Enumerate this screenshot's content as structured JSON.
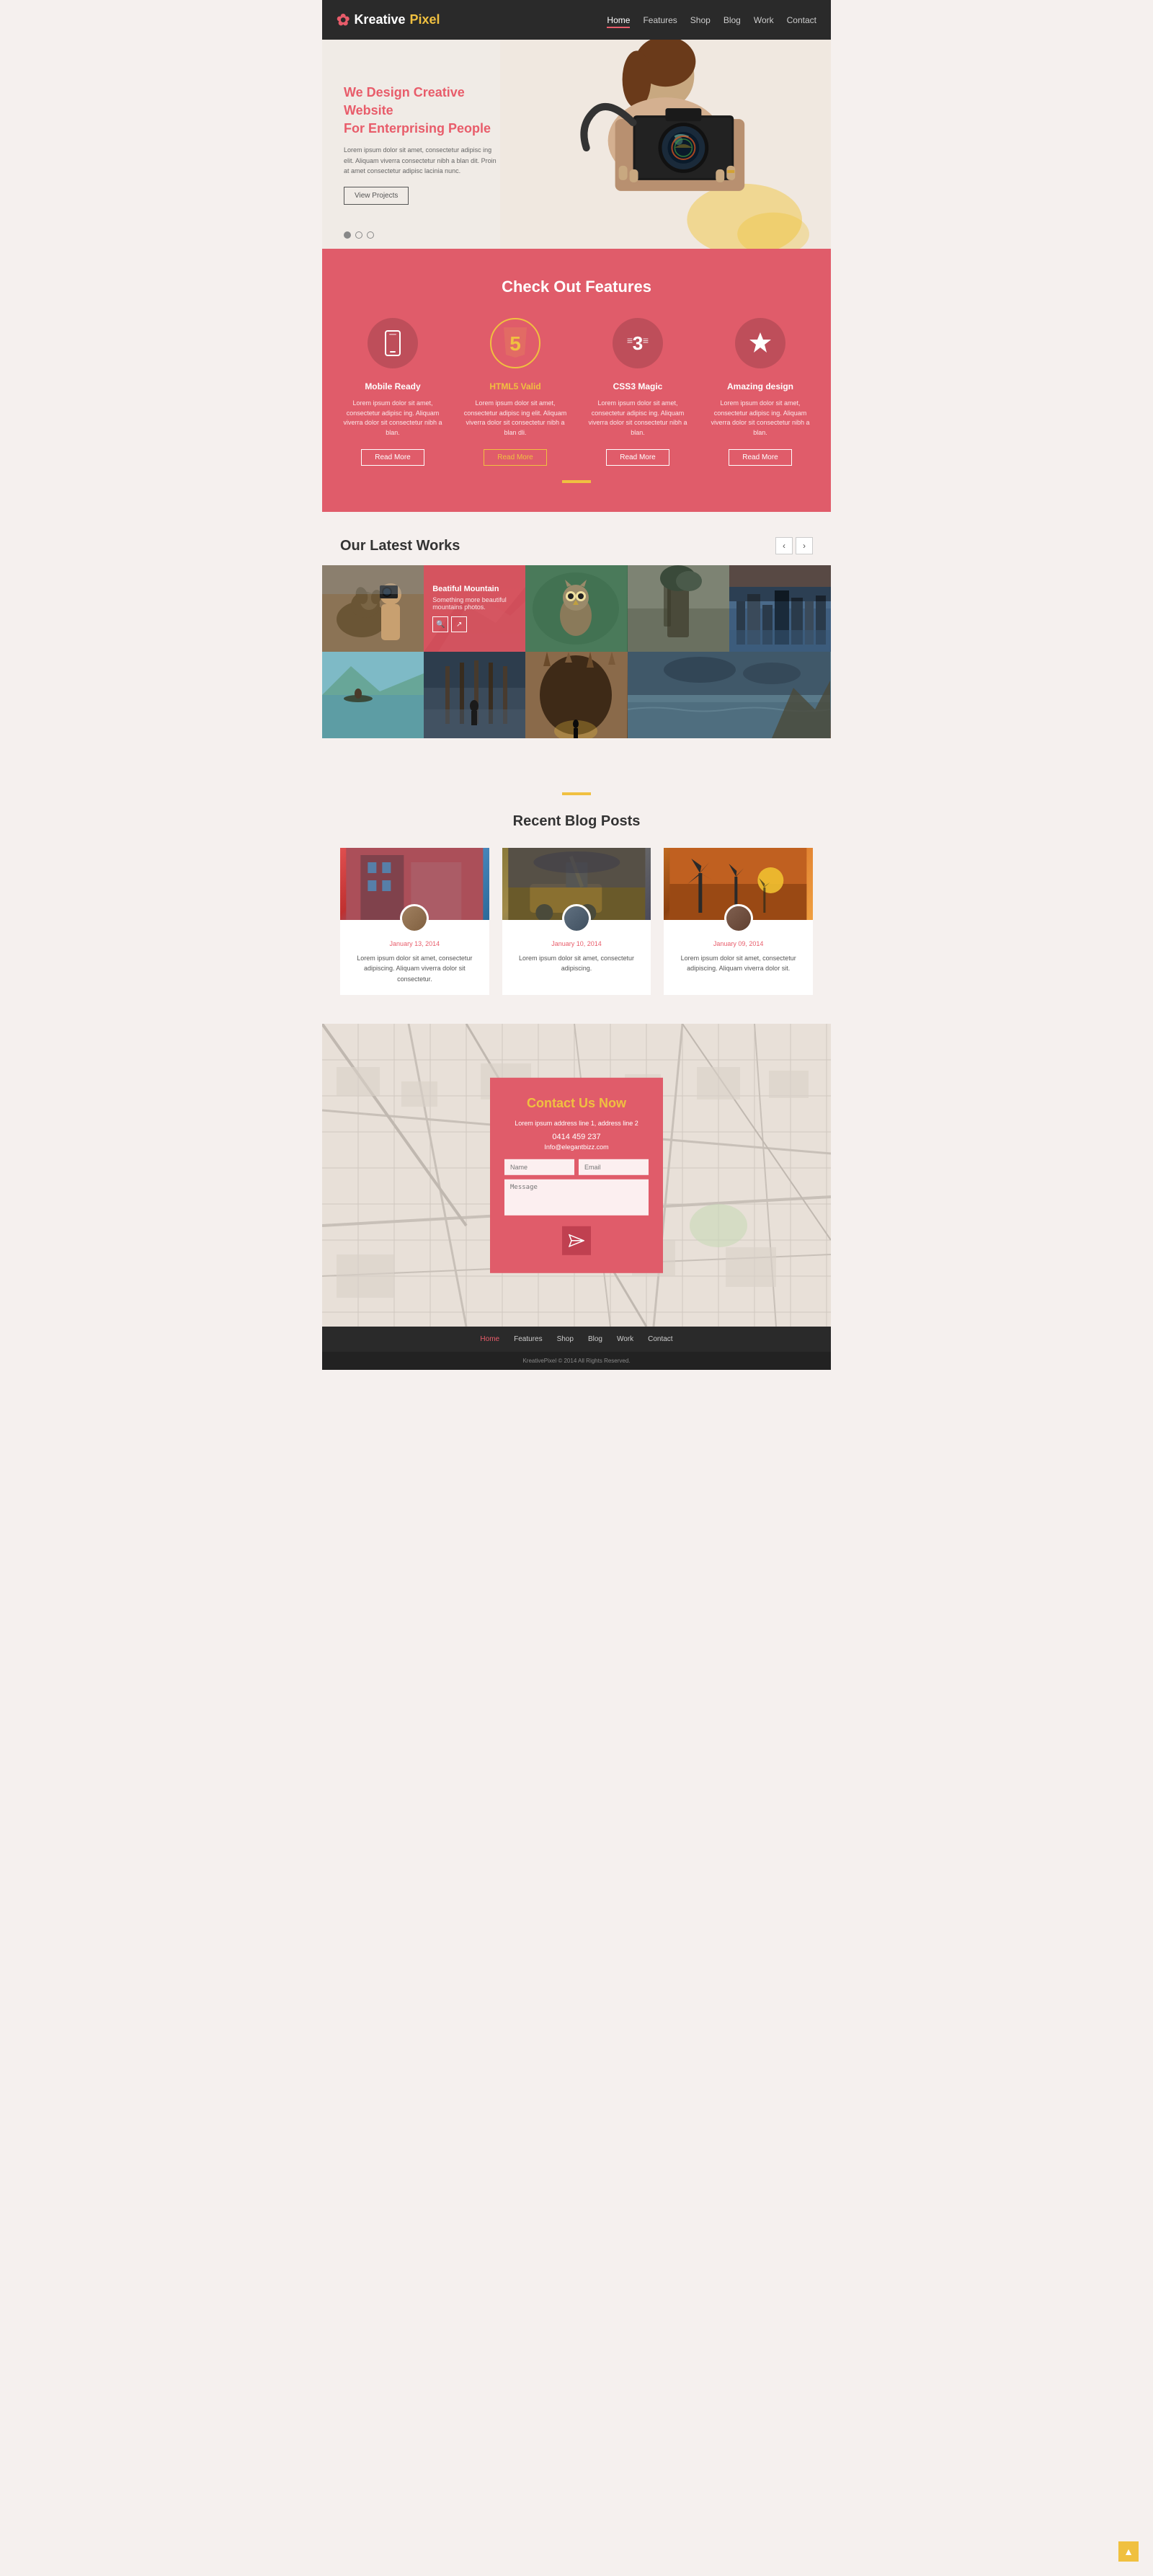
{
  "brand": {
    "logo_symbol": "✿",
    "name_kreative": "Kreative",
    "name_pixel": "Pixel"
  },
  "nav": {
    "links": [
      {
        "label": "Home",
        "active": true
      },
      {
        "label": "Features",
        "active": false
      },
      {
        "label": "Shop",
        "active": false
      },
      {
        "label": "Blog",
        "active": false
      },
      {
        "label": "Work",
        "active": false
      },
      {
        "label": "Contact",
        "active": false
      }
    ]
  },
  "hero": {
    "title_line1": "We Design",
    "title_highlight": "Creative Website",
    "title_line2": "For Enterprising People",
    "description": "Lorem ipsum dolor sit amet, consectetur adipisc ing elit. Aliquam viverra consectetur nibh a blan dit. Proin at amet consectetur adipisc lacinia nunc.",
    "cta_label": "View Projects"
  },
  "features": {
    "section_title_normal": "Check Out",
    "section_title_bold": "Features",
    "items": [
      {
        "icon": "📱",
        "icon_symbol": "☰",
        "title": "Mobile Ready",
        "highlight": false,
        "description": "Lorem ipsum dolor sit amet, consectetur adipisc ing. Aliquam viverra  dolor sit consectetur nibh a blan.",
        "btn_label": "Read More"
      },
      {
        "icon": "5",
        "icon_symbol": "5",
        "title": "HTML5 Valid",
        "highlight": true,
        "description": "Lorem ipsum dolor sit amet, consectetur adipisc ing elit. Aliquam viverra  dolor sit consectetur nibh a blan dli.",
        "btn_label": "Read More"
      },
      {
        "icon": "3",
        "icon_symbol": "≡",
        "title": "CSS3 Magic",
        "highlight": false,
        "description": "Lorem ipsum dolor sit amet, consectetur adipisc ing. Aliquam viverra  dolor sit consectetur nibh a blan.",
        "btn_label": "Read More"
      },
      {
        "icon": "★",
        "icon_symbol": "★",
        "title": "Amazing design",
        "highlight": false,
        "description": "Lorem ipsum dolor sit amet, consectetur adipisc ing. Aliquam viverra  dolor sit consectetur nibh a blan.",
        "btn_label": "Read More"
      }
    ]
  },
  "works": {
    "section_title_normal": "Our Latest",
    "section_title_bold": "Works",
    "prev_btn": "‹",
    "next_btn": "›",
    "items": [
      {
        "id": 1,
        "style": "photo-dog",
        "active": false
      },
      {
        "id": 2,
        "title": "Beatiful Mountain",
        "subtitle": "Something more beautiful mountains photos.",
        "style": "photo-mountain",
        "active": true
      },
      {
        "id": 3,
        "style": "photo-owl",
        "active": false
      },
      {
        "id": 4,
        "style": "photo-rock",
        "active": false
      },
      {
        "id": 5,
        "style": "photo-city",
        "active": false
      },
      {
        "id": 6,
        "style": "photo-lake",
        "active": false
      },
      {
        "id": 7,
        "style": "photo-pier",
        "active": false
      },
      {
        "id": 8,
        "style": "photo-cave",
        "active": false
      },
      {
        "id": 9,
        "style": "photo-cliff",
        "active": false
      }
    ]
  },
  "blog": {
    "section_title_normal": "Recent",
    "section_title_bold": "Blog Posts",
    "posts": [
      {
        "date": "January 13, 2014",
        "text": "Lorem ipsum dolor sit amet, consectetur adipiscing. Aliquam viverra  dolor sit consectetur.",
        "img_style": "blog-img-1",
        "avatar_style": "blog-avatar-1"
      },
      {
        "date": "January 10, 2014",
        "text": "Lorem ipsum dolor sit amet, consectetur adipiscing.",
        "img_style": "blog-img-2",
        "avatar_style": "blog-avatar-2"
      },
      {
        "date": "January 09, 2014",
        "text": "Lorem ipsum dolor sit amet, consectetur adipiscing. Aliquam viverra  dolor sit.",
        "img_style": "blog-img-3",
        "avatar_style": "blog-avatar-3"
      }
    ]
  },
  "contact": {
    "title": "Contact Us Now",
    "address1": "Lorem ipsum address line 1, address line 2",
    "phone": "0414 459 237",
    "email": "Info@elegantbizz.com",
    "name_placeholder": "Name",
    "email_placeholder": "Email",
    "message_placeholder": "Message"
  },
  "footer": {
    "links": [
      "Home",
      "Features",
      "Shop",
      "Blog",
      "Work",
      "Contact"
    ],
    "copyright": "KreativePixel © 2014 All Rights Reserved."
  }
}
